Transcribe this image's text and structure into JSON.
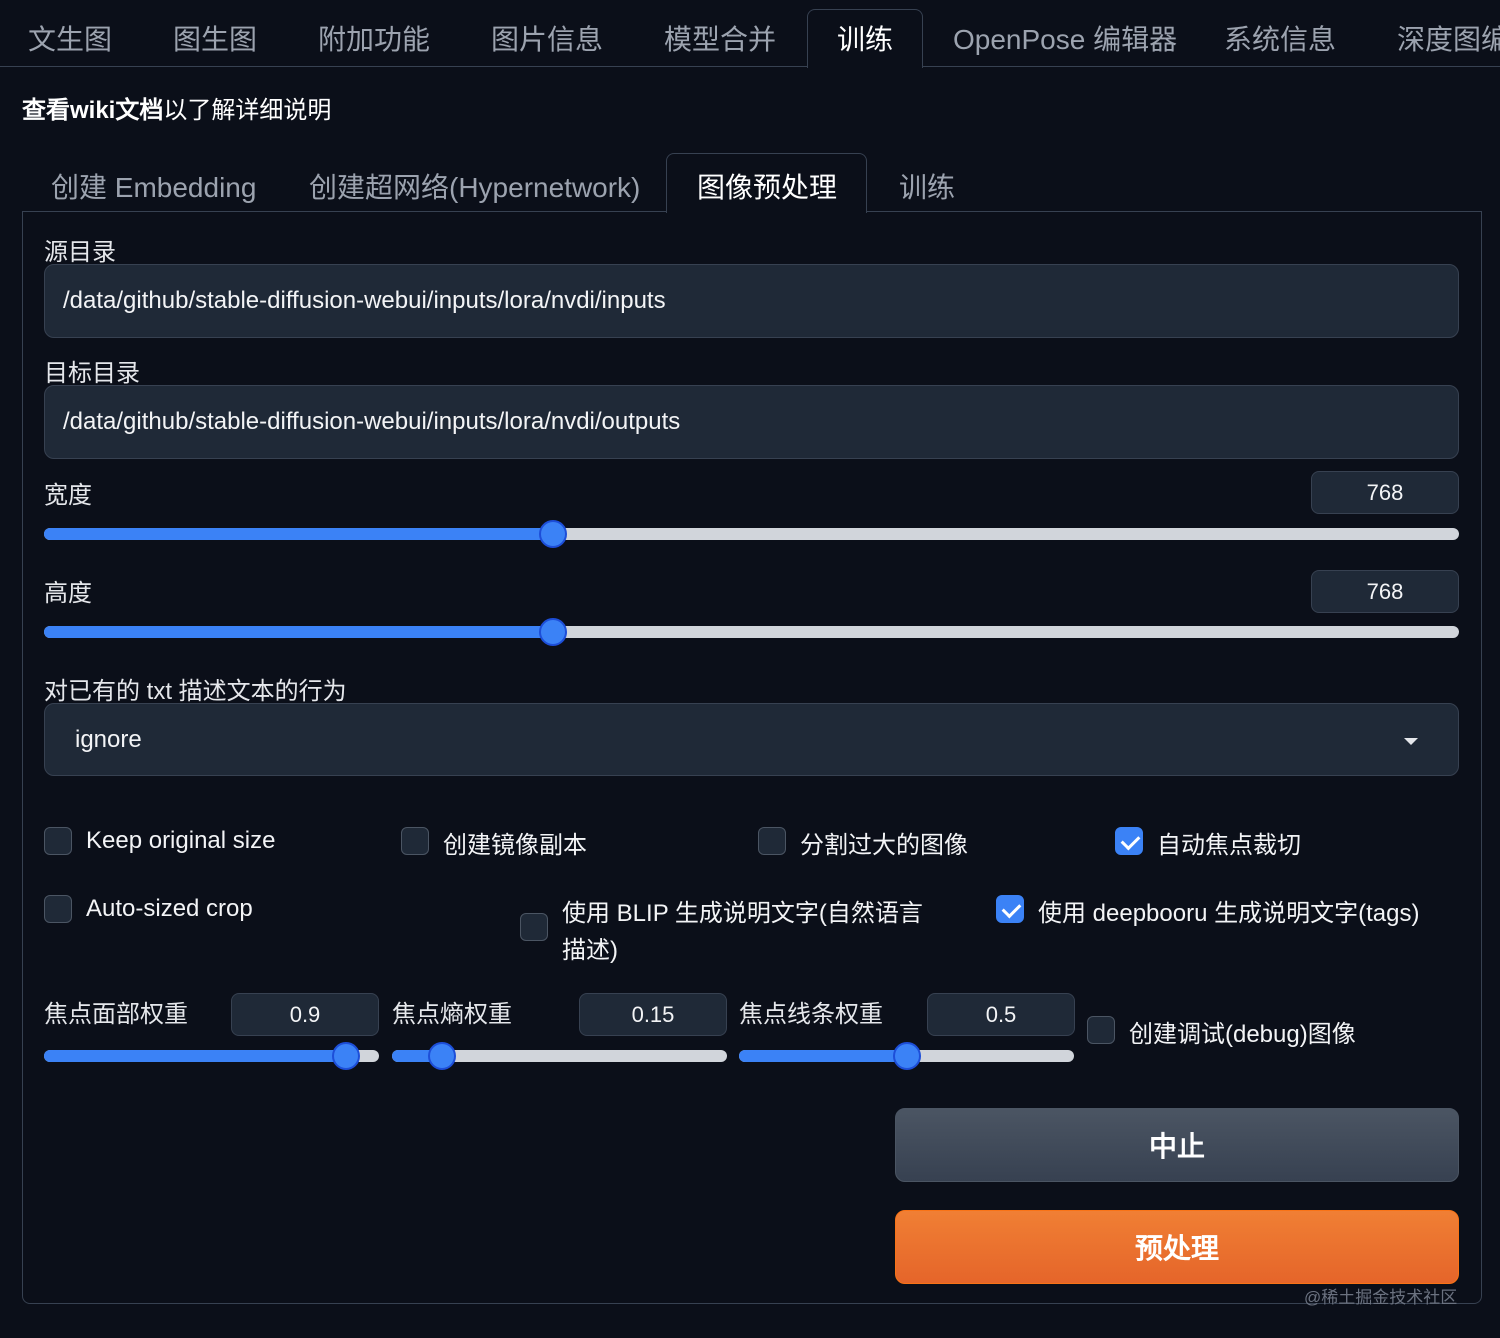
{
  "top_tabs": [
    "文生图",
    "图生图",
    "附加功能",
    "图片信息",
    "模型合并",
    "训练",
    "OpenPose 编辑器",
    "系统信息",
    "深度图编"
  ],
  "active_top_tab": "训练",
  "wiki_link": {
    "bold": "查看wiki文档",
    "rest": "以了解详细说明"
  },
  "sub_tabs": [
    "创建 Embedding",
    "创建超网络(Hypernetwork)",
    "图像预处理",
    "训练"
  ],
  "active_sub_tab": "图像预处理",
  "source_dir": {
    "label": "源目录",
    "value": "/data/github/stable-diffusion-webui/inputs/lora/nvdi/inputs"
  },
  "target_dir": {
    "label": "目标目录",
    "value": "/data/github/stable-diffusion-webui/inputs/lora/nvdi/outputs"
  },
  "width": {
    "label": "宽度",
    "value": "768",
    "fraction": 0.36
  },
  "height": {
    "label": "高度",
    "value": "768",
    "fraction": 0.36
  },
  "txt_action": {
    "label": "对已有的 txt 描述文本的行为",
    "value": "ignore"
  },
  "checkboxes": {
    "keep_original_size": {
      "label": "Keep original size",
      "checked": false
    },
    "create_flipped": {
      "label": "创建镜像副本",
      "checked": false
    },
    "split_oversized": {
      "label": "分割过大的图像",
      "checked": false
    },
    "auto_focal_crop": {
      "label": "自动焦点裁切",
      "checked": true
    },
    "auto_sized_crop": {
      "label": "Auto-sized crop",
      "checked": false
    },
    "blip_caption": {
      "label_line1": "使用 BLIP 生成说明文字(自然语言",
      "label_line2": "描述)",
      "checked": false
    },
    "deepbooru_caption": {
      "label": "使用 deepbooru 生成说明文字(tags)",
      "checked": true
    },
    "debug_images": {
      "label": "创建调试(debug)图像",
      "checked": false
    }
  },
  "focal_face_weight": {
    "label": "焦点面部权重",
    "value": "0.9",
    "fraction": 0.9
  },
  "focal_entropy_weight": {
    "label": "焦点熵权重",
    "value": "0.15",
    "fraction": 0.15
  },
  "focal_edges_weight": {
    "label": "焦点线条权重",
    "value": "0.5",
    "fraction": 0.5
  },
  "buttons": {
    "interrupt": "中止",
    "preprocess": "预处理"
  },
  "watermark": "@稀土掘金技术社区",
  "colors": {
    "accent": "#3b82f6",
    "primary_button": "#e5652a",
    "background": "#0b0f19"
  }
}
